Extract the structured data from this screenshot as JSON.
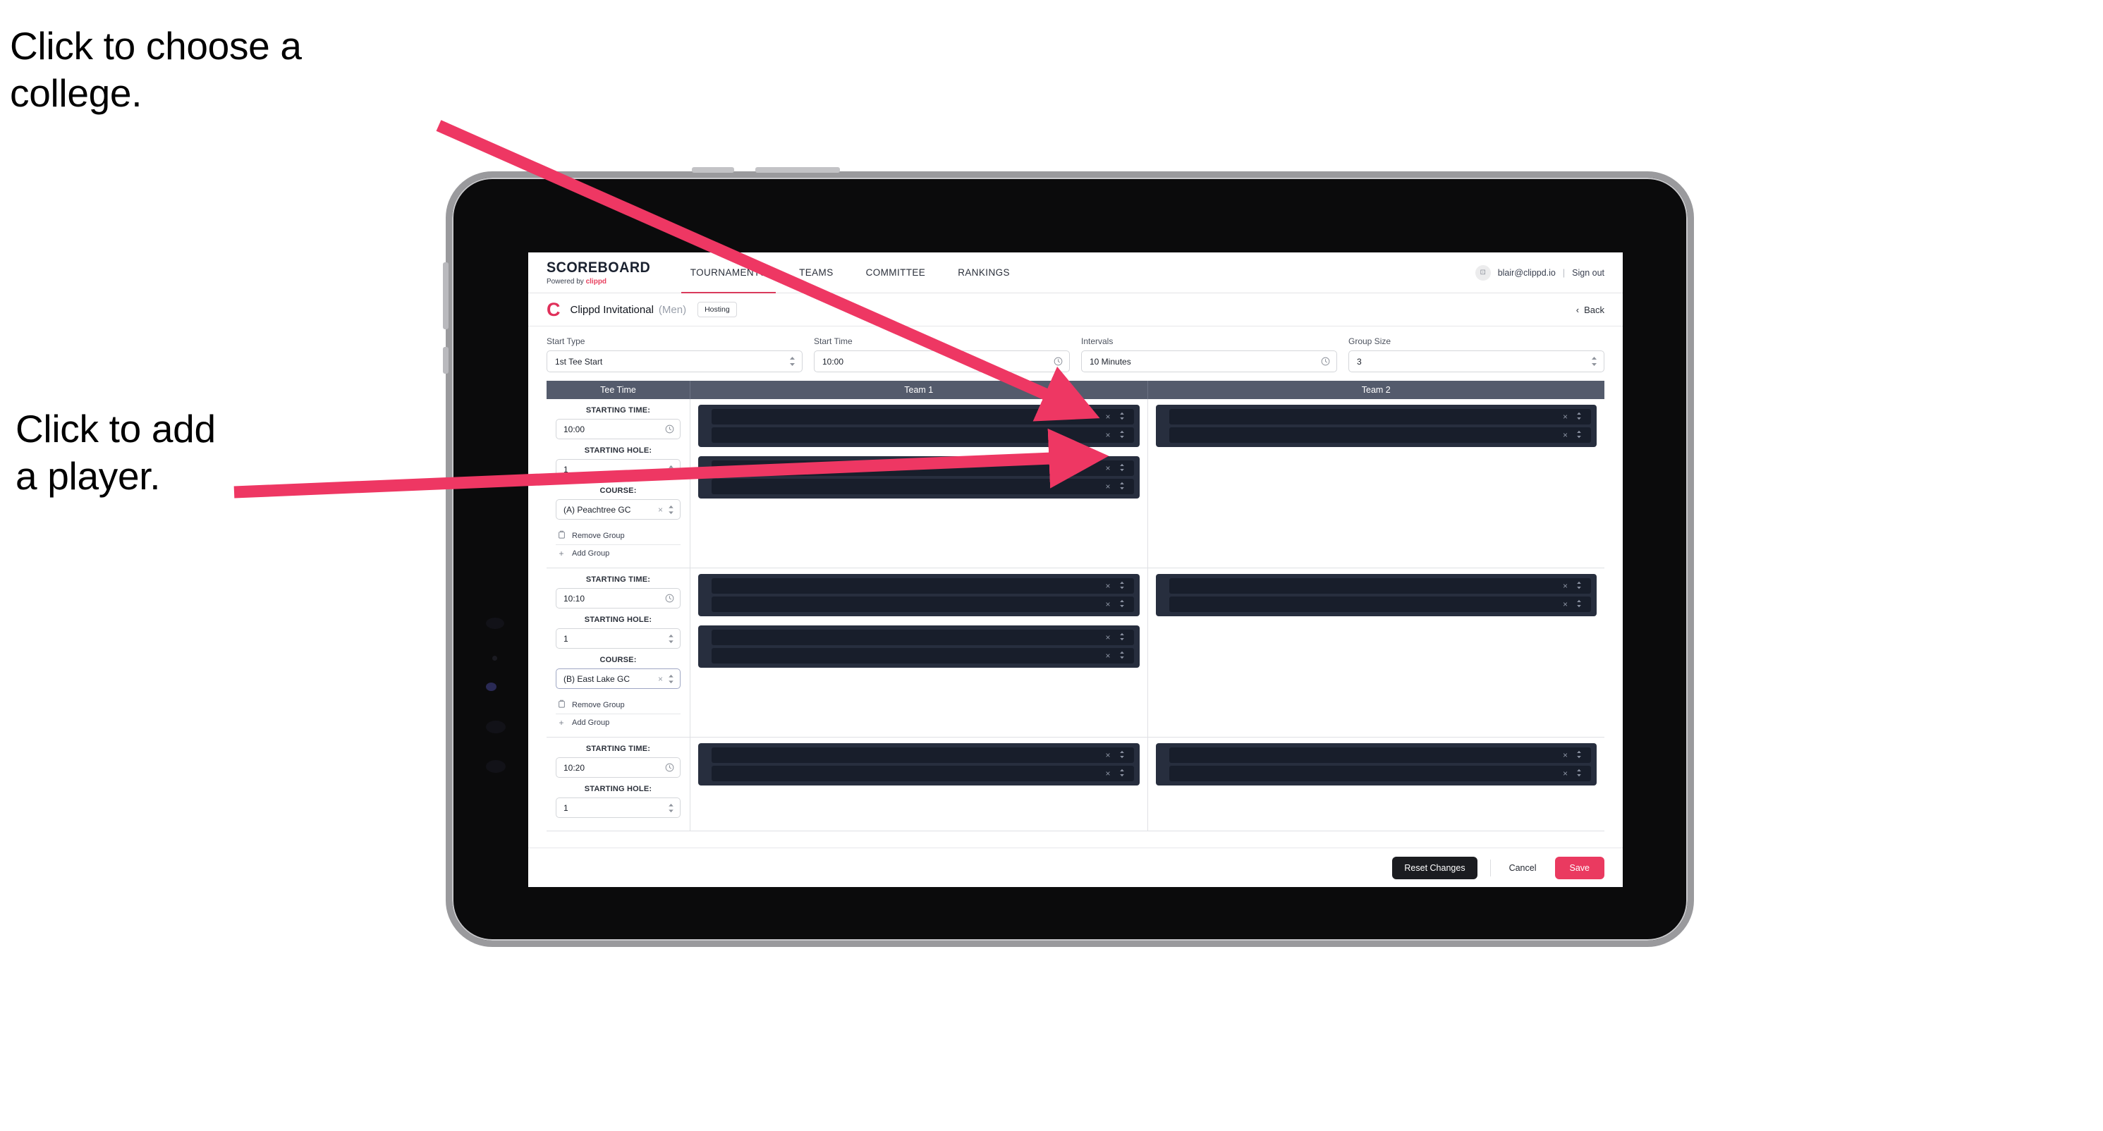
{
  "annotations": {
    "college": "Click to choose a\ncollege.",
    "player": "Click to add\na player.",
    "arrow_color": "#EE3763"
  },
  "nav": {
    "brand_word": "SCOREBOARD",
    "brand_sub_prefix": "Powered by ",
    "brand_sub_name": "clippd",
    "links": [
      {
        "label": "TOURNAMENTS",
        "active": true
      },
      {
        "label": "TEAMS",
        "active": false
      },
      {
        "label": "COMMITTEE",
        "active": false
      },
      {
        "label": "RANKINGS",
        "active": false
      }
    ],
    "avatar_glyph": "⊡",
    "user_email": "blair@clippd.io",
    "separator": "|",
    "sign_out": "Sign out"
  },
  "breadcrumb": {
    "logo": "C",
    "title": "Clippd Invitational",
    "gender": "(Men)",
    "badge": "Hosting",
    "back_icon": "‹",
    "back_label": "Back"
  },
  "controls": [
    {
      "label": "Start Type",
      "value": "1st Tee Start",
      "icon": "spinner"
    },
    {
      "label": "Start Time",
      "value": "10:00",
      "icon": "clock"
    },
    {
      "label": "Intervals",
      "value": "10 Minutes",
      "icon": "clock"
    },
    {
      "label": "Group Size",
      "value": "3",
      "icon": "spinner"
    }
  ],
  "table": {
    "headers": {
      "tee_time": "Tee Time",
      "team1": "Team 1",
      "team2": "Team 2"
    },
    "labels": {
      "starting_time": "STARTING TIME:",
      "starting_hole": "STARTING HOLE:",
      "course": "COURSE:",
      "remove_group": "Remove Group",
      "add_group": "Add Group",
      "remove_icon": "☐",
      "add_icon": "+",
      "clear_icon": "×",
      "spinner_icon": "⌃⌄",
      "clock_icon": "◷"
    },
    "groups": [
      {
        "starting_time": "10:00",
        "starting_hole": "1",
        "course": "(A) Peachtree GC",
        "course_focused": false,
        "team1_pairs": 2,
        "team2_pairs": 1
      },
      {
        "starting_time": "10:10",
        "starting_hole": "1",
        "course": "(B) East Lake GC",
        "course_focused": true,
        "team1_pairs": 2,
        "team2_pairs": 1
      },
      {
        "starting_time": "10:20",
        "starting_hole": "1",
        "course": "",
        "course_focused": false,
        "team1_pairs": 1,
        "team2_pairs": 1
      }
    ]
  },
  "footer": {
    "reset": "Reset Changes",
    "cancel": "Cancel",
    "save": "Save",
    "save_color": "#ea3a60"
  }
}
